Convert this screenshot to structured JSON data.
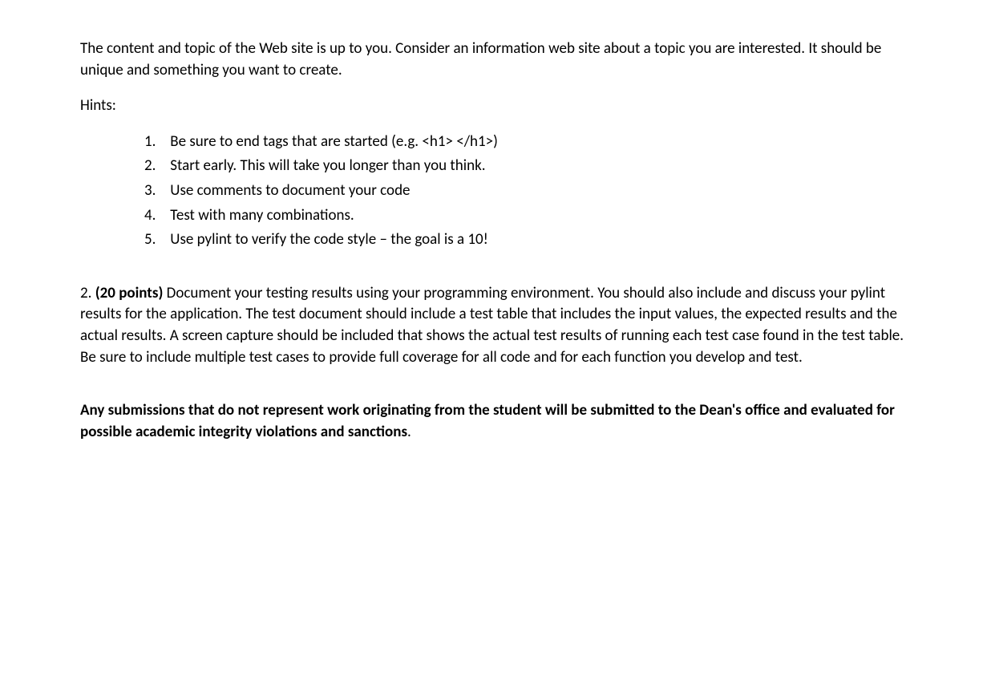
{
  "intro_paragraph": "The content and topic of the Web site is up to you. Consider an information web site about a topic you are interested. It should be unique and something you want to create.",
  "hints_label": "Hints:",
  "hints": [
    {
      "num": "1.",
      "text": "Be sure to end tags that are started (e.g. <h1> </h1>)"
    },
    {
      "num": "2.",
      "text": "Start early. This will take you longer than you think."
    },
    {
      "num": "3.",
      "text": "Use comments to document your code"
    },
    {
      "num": "4.",
      "text": "Test with many combinations."
    },
    {
      "num": "5.",
      "text": "Use pylint to verify the code style – the goal is a 10!"
    }
  ],
  "section2": {
    "prefix": "2. ",
    "points_label": "(20 points)",
    "body": " Document your testing results using your programming environment. You should also include and discuss your pylint results for the application. The test document should include a test table that includes the input values, the expected results and the actual results. A screen capture should be included that shows the actual test results of running each test case found in the test table. Be sure to include multiple test cases to provide full coverage for all code and for each function you develop and test."
  },
  "integrity_notice_bold": "Any submissions that do not represent work originating from the student will be submitted to the Dean's office and evaluated for possible academic integrity violations and sanctions",
  "integrity_notice_period": "."
}
